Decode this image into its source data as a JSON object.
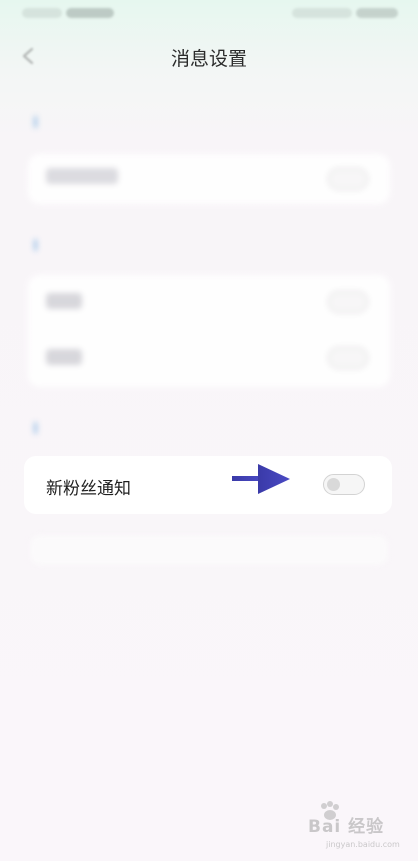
{
  "nav": {
    "title": "消息设置"
  },
  "settings": {
    "new_fans_notification": {
      "label": "新粉丝通知",
      "enabled": false
    }
  },
  "watermark": {
    "brand_lettering": "Bai 经验",
    "sub_lettering": "jingyan.baidu.com"
  },
  "icons": {
    "back": "back-arrow-icon",
    "annotation_arrow": "right-arrow-icon"
  },
  "colors": {
    "annotation_arrow": "#3f3fb3",
    "toggle_off_knob": "#d9d9d9"
  }
}
